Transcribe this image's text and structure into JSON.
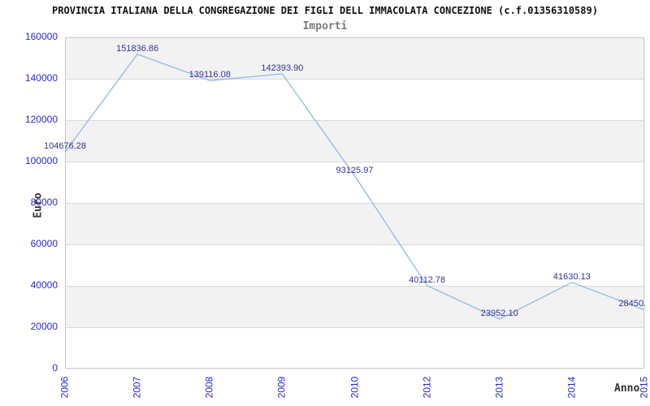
{
  "chart_data": {
    "type": "line",
    "title": "PROVINCIA ITALIANA DELLA CONGREGAZIONE DEI FIGLI DELL IMMACOLATA CONCEZIONE (c.f.01356310589)",
    "subtitle": "Importi",
    "xlabel": "Anno",
    "ylabel": "Euro",
    "categories": [
      "2006",
      "2007",
      "2008",
      "2009",
      "2010",
      "2012",
      "2013",
      "2014",
      "2015"
    ],
    "values": [
      104676.28,
      151836.86,
      139116.08,
      142393.9,
      93125.97,
      40112.78,
      23952.1,
      41630.13,
      28450
    ],
    "point_labels": [
      "104676.28",
      "151836.86",
      "139116.08",
      "142393.90",
      "93125.97",
      "40112.78",
      "23952.10",
      "41630.13",
      "28450."
    ],
    "yticks": [
      "0",
      "20000",
      "40000",
      "60000",
      "80000",
      "100000",
      "120000",
      "140000",
      "160000"
    ],
    "ylim": [
      0,
      160000
    ],
    "ytick_step": 20000,
    "legend": "none",
    "grid": "horizontal",
    "banded_background": true,
    "colors": {
      "line": "#8fb8e8",
      "tick_labels": "#2929cc",
      "point_labels": "#333399",
      "band": "#f2f2f2",
      "gridline": "#d9d9d9",
      "plot_border": "#c6c6c6",
      "title": "#111111",
      "subtitle": "#7a7a7a",
      "axis_titles": "#333333"
    }
  }
}
